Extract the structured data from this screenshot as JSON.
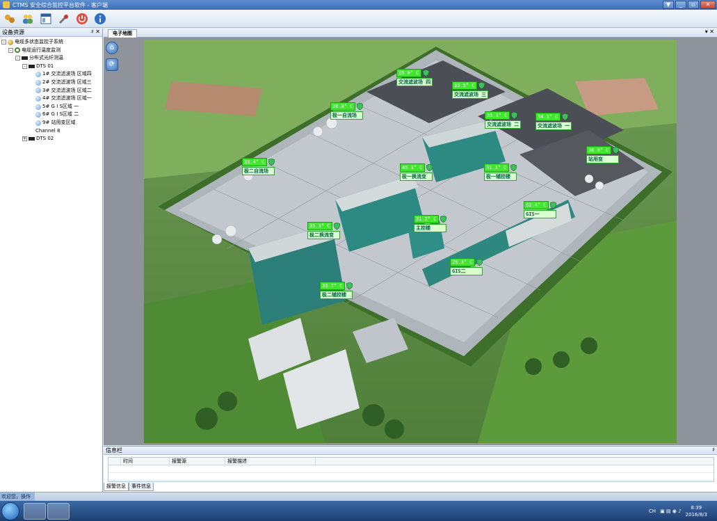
{
  "window": {
    "title": "CTMS 安全综合监控平台软件 - 客户端",
    "min": "▼",
    "minimize": "_",
    "restore": "▫",
    "close": "✕"
  },
  "toolbar": {
    "icons": [
      "settings-group-icon",
      "users-icon",
      "layout-icon",
      "tools-icon",
      "power-icon",
      "info-icon"
    ]
  },
  "left_panel": {
    "title": "设备资源",
    "pin": "♯",
    "close": "✕",
    "tree": [
      {
        "level": 0,
        "icon": "globe",
        "exp": "-",
        "label": "电缆多状态监控子系统"
      },
      {
        "level": 1,
        "icon": "ring",
        "exp": "-",
        "label": "电缆运行温度监测"
      },
      {
        "level": 2,
        "icon": "dev",
        "exp": "-",
        "label": "分布式光纤测温"
      },
      {
        "level": 3,
        "icon": "dev",
        "exp": "-",
        "label": "DTS 01"
      },
      {
        "level": 4,
        "icon": "dot",
        "exp": "",
        "label": "1# 交流滤波场 区域四"
      },
      {
        "level": 4,
        "icon": "dot",
        "exp": "",
        "label": "2# 交流滤波场 区域三"
      },
      {
        "level": 4,
        "icon": "dot",
        "exp": "",
        "label": "3# 交流滤波场 区域二"
      },
      {
        "level": 4,
        "icon": "dot",
        "exp": "",
        "label": "4# 交流滤波场 区域一"
      },
      {
        "level": 4,
        "icon": "dot",
        "exp": "",
        "label": "5# G I S区域 一"
      },
      {
        "level": 4,
        "icon": "dot",
        "exp": "",
        "label": "6# G I S区域 二"
      },
      {
        "level": 4,
        "icon": "dot",
        "exp": "",
        "label": "9# 站用变区域"
      },
      {
        "level": 4,
        "icon": "none",
        "exp": "",
        "label": "Channel 8"
      },
      {
        "level": 3,
        "icon": "dev",
        "exp": "+",
        "label": "DTS 02"
      }
    ]
  },
  "main": {
    "tab": "电子地图",
    "tab_menu": "▾ ✕"
  },
  "markers": [
    {
      "temp": "35.0° C",
      "label": "交流滤波场 四"
    },
    {
      "temp": "33.5° C",
      "label": "交流滤波场 三"
    },
    {
      "temp": "28.8° C",
      "label": "极一自流场"
    },
    {
      "temp": "35.1° C",
      "label": "交流滤波场 二"
    },
    {
      "temp": "34.1° C",
      "label": "交流滤波场 一"
    },
    {
      "temp": "36.0° C",
      "label": "站用变"
    },
    {
      "temp": "33.4° C",
      "label": "极二自流场"
    },
    {
      "temp": "45.1° C",
      "label": "极一换流变"
    },
    {
      "temp": "31.1° C",
      "label": "极一辅控楼"
    },
    {
      "temp": "32.4° C",
      "label": "GIS一"
    },
    {
      "temp": "31.2° C",
      "label": "主控楼"
    },
    {
      "temp": "35.3° C",
      "label": "极二换流变"
    },
    {
      "temp": "29.3° C",
      "label": "GIS二"
    },
    {
      "temp": "33.7° C",
      "label": "极二辅控楼"
    }
  ],
  "info_panel": {
    "title": "信息栏",
    "pin": "♯",
    "columns": [
      "时间",
      "报警源",
      "报警描述"
    ],
    "tabs": [
      "报警信息",
      "事件信息"
    ]
  },
  "status": {
    "text": "欢迎您，操作员"
  },
  "taskbar": {
    "lang": "CH",
    "time": "8:39",
    "date": "2016/8/3"
  },
  "colors": {
    "marker_green": "#3ee82a",
    "title_blue": "#3b6fb8"
  }
}
